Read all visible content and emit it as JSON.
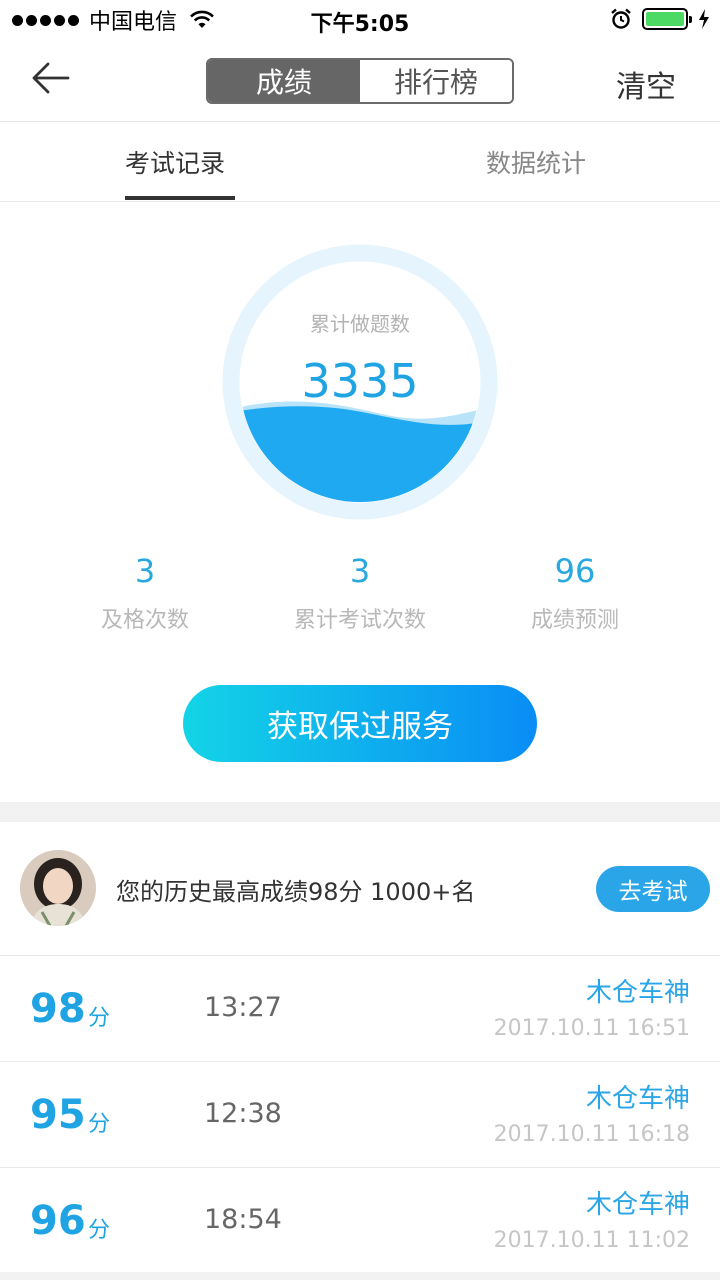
{
  "status_bar": {
    "carrier": "中国电信",
    "time": "下午5:05"
  },
  "nav": {
    "segments": [
      "成绩",
      "排行榜"
    ],
    "active_segment": "成绩",
    "clear_label": "清空"
  },
  "tabs": {
    "items": [
      "考试记录",
      "数据统计"
    ],
    "active": "考试记录"
  },
  "summary": {
    "total_label": "累计做题数",
    "total_value": "3335",
    "stats": [
      {
        "value": "3",
        "label": "及格次数"
      },
      {
        "value": "3",
        "label": "累计考试次数"
      },
      {
        "value": "96",
        "label": "成绩预测"
      }
    ],
    "cta_label": "获取保过服务"
  },
  "best": {
    "text": "您的历史最高成绩98分 1000+名",
    "button_label": "去考试"
  },
  "records": [
    {
      "score": "98",
      "unit": "分",
      "duration": "13:27",
      "name": "木仓车神",
      "date": "2017.10.11 16:51"
    },
    {
      "score": "95",
      "unit": "分",
      "duration": "12:38",
      "name": "木仓车神",
      "date": "2017.10.11 16:18"
    },
    {
      "score": "96",
      "unit": "分",
      "duration": "18:54",
      "name": "木仓车神",
      "date": "2017.10.11 11:02"
    }
  ],
  "colors": {
    "accent": "#1fa3e3",
    "segment_active": "#666666",
    "button_gradient_start": "#13d4e6",
    "button_gradient_end": "#0a8df5",
    "battery": "#4cd964"
  }
}
